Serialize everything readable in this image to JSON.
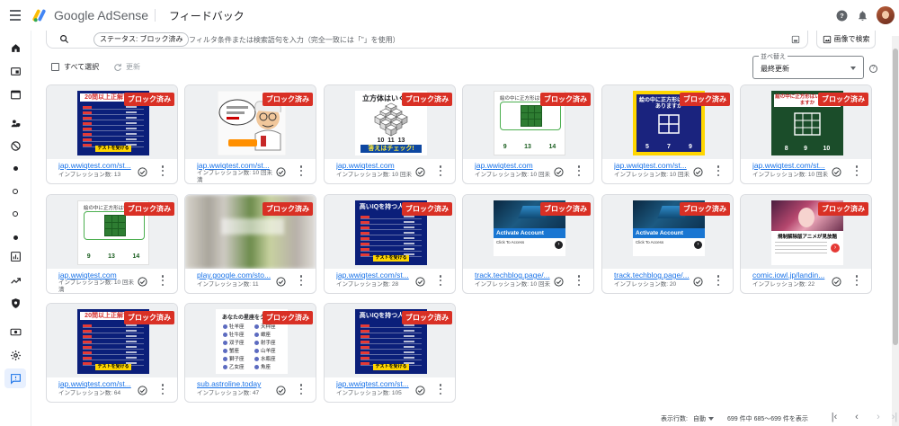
{
  "app": {
    "product_name": "Google AdSense",
    "page_title": "フィードバック",
    "icons": [
      "menu-icon",
      "adsense-logo-icon",
      "help-icon",
      "notifications-icon",
      "avatar"
    ]
  },
  "sidebar": {
    "items": [
      {
        "name": "home-icon"
      },
      {
        "name": "ads-icon"
      },
      {
        "name": "sites-icon"
      },
      {
        "name": "privacy-icon"
      },
      {
        "name": "block-icon"
      },
      {
        "name": "dot-icon"
      },
      {
        "name": "ring-icon"
      },
      {
        "name": "ring-icon"
      },
      {
        "name": "dot-icon"
      },
      {
        "name": "reports-icon"
      },
      {
        "name": "optimization-icon"
      },
      {
        "name": "policy-shield-icon"
      },
      {
        "name": "payments-icon"
      },
      {
        "name": "settings-icon"
      },
      {
        "name": "feedback-icon"
      }
    ]
  },
  "filter": {
    "chip_label": "ステータス: ブロック済み",
    "placeholder": "フィルタ条件または検索語句を入力（完全一致には「\"」を使用）",
    "image_search_label": "画像で検索"
  },
  "toolbar": {
    "select_all_label": "すべて選択",
    "refresh_label": "更新",
    "sort_label": "並べ替え",
    "sort_value": "最終更新"
  },
  "badge_label": "ブロック済み",
  "cards": [
    {
      "kind": "quiz",
      "quiz_title": "20問以上正解できる",
      "url": "jap.wwiqtest.com/st...",
      "impressions": "インプレッション数: 13",
      "wrap": false
    },
    {
      "kind": "professor",
      "url": "jap.wwiqtest.com/st...",
      "impressions": "インプレッション数: 10 回未満",
      "wrap": true
    },
    {
      "kind": "cubes",
      "cube_title": "立方体はいくつあ",
      "cube_nums": "10  11  13",
      "cube_btn": "答えはチェック!",
      "url": "jap.wwiqtest.com",
      "impressions": "インプレッション数: 10 回未満",
      "wrap": false
    },
    {
      "kind": "square",
      "square_title": "絵の中に正方形はいくつあ",
      "square_nums": [
        "9",
        "13",
        "14"
      ],
      "url": "jap.wwiqtest.com",
      "impressions": "インプレッション数: 10 回未満",
      "wrap": false
    },
    {
      "kind": "yellow",
      "yellow_title": "絵の中に正方形はいくつありますか",
      "yellow_nums": [
        "5",
        "7",
        "9"
      ],
      "url": "jap.wwiqtest.com/st...",
      "impressions": "インプレッション数: 10 回未満",
      "wrap": false
    },
    {
      "kind": "greenboard",
      "green_title": "絵の中に正方形はいくつありますか",
      "green_nums": [
        "8",
        "9",
        "10"
      ],
      "url": "jap.wwiqtest.com/st...",
      "impressions": "インプレッション数: 10 回未満",
      "wrap": false
    },
    {
      "kind": "square",
      "square_title": "絵の中に正方形はいくつあ",
      "square_nums": [
        "9",
        "13",
        "14"
      ],
      "url": "jap.wwiqtest.com",
      "impressions": "インプレッション数: 10 回未満",
      "wrap": true
    },
    {
      "kind": "blurred",
      "url": "play.google.com/sto...",
      "impressions": "インプレッション数: 11",
      "wrap": false
    },
    {
      "kind": "quiz2",
      "quiz_title": "高いIQを持つ人だけが",
      "url": "jap.wwiqtest.com/st...",
      "impressions": "インプレッション数: 28",
      "wrap": false
    },
    {
      "kind": "tech",
      "activate": "Activate Account",
      "click": "Click To Access",
      "url": "track.techblog.page/...",
      "impressions": "インプレッション数: 10 回未満",
      "wrap": false
    },
    {
      "kind": "tech",
      "activate": "Activate Account",
      "click": "Click To Access",
      "url": "track.techblog.page/...",
      "impressions": "インプレッション数: 20",
      "wrap": false
    },
    {
      "kind": "anime",
      "anime_caption": "規制解除版アニメが見放題",
      "url": "comic.iowl.jp/landin...",
      "impressions": "インプレッション数: 22",
      "wrap": false
    },
    {
      "kind": "quiz",
      "quiz_title": "20問以上正解できる",
      "url": "jap.wwiqtest.com/st...",
      "impressions": "インプレッション数: 64",
      "wrap": false
    },
    {
      "kind": "horoscope",
      "horo_title": "あなたの星座をクリック",
      "signs": [
        "牡羊座",
        "天秤座",
        "牡牛座",
        "蠍座",
        "双子座",
        "射手座",
        "蟹座",
        "山羊座",
        "獅子座",
        "水瓶座",
        "乙女座",
        "魚座"
      ],
      "url": "sub.astroline.today",
      "impressions": "インプレッション数: 47",
      "wrap": false
    },
    {
      "kind": "quiz2",
      "quiz_title": "高いIQを持つ人だけが",
      "url": "jap.wwiqtest.com/st...",
      "impressions": "インプレッション数: 105",
      "wrap": false
    }
  ],
  "quiz_button": "テストを受ける",
  "footer": {
    "rows_label": "表示行数:",
    "rows_value": "自動",
    "range_text": "699 件中 685〜699 件を表示"
  },
  "colors": {
    "badge": "#d93025",
    "link": "#1a73e8",
    "active_nav": "#e8f0fe"
  }
}
